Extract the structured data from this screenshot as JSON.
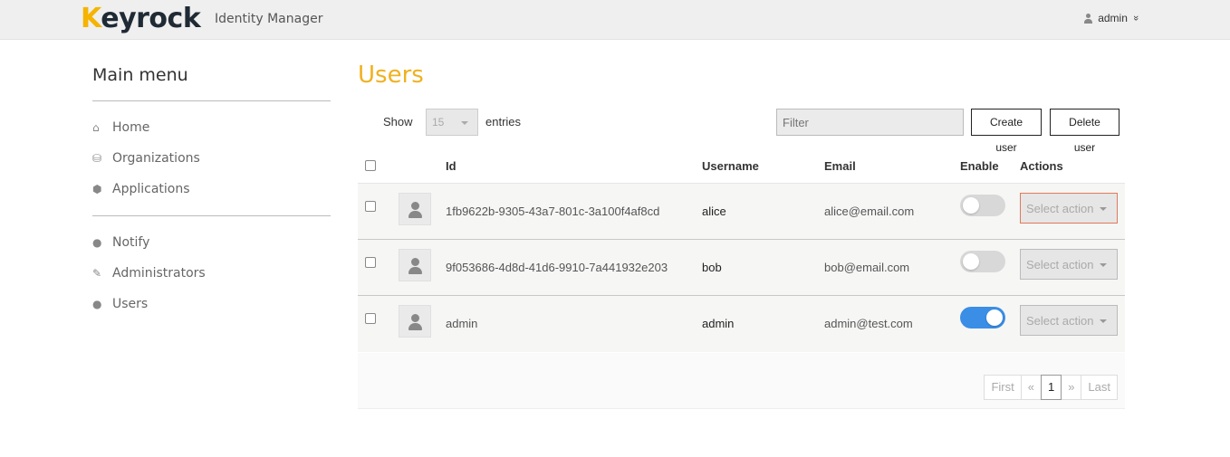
{
  "header": {
    "logo_k": "K",
    "logo_rest": "eyrock",
    "app_title": "Identity Manager",
    "user_label": "admin",
    "user_caret": "»"
  },
  "sidebar": {
    "title": "Main menu",
    "items": [
      {
        "label": "Home",
        "icon": "⌂"
      },
      {
        "label": "Organizations",
        "icon": "⛁"
      },
      {
        "label": "Applications",
        "icon": "⬢"
      },
      {
        "label": "Notify",
        "icon": "●"
      },
      {
        "label": "Administrators",
        "icon": "✎"
      },
      {
        "label": "Users",
        "icon": "●"
      }
    ]
  },
  "main": {
    "title": "Users",
    "show_label": "Show",
    "entries_value": "15",
    "entries_label": "entries",
    "filter_placeholder": "Filter",
    "create_label": "Create user",
    "delete_label": "Delete user"
  },
  "table": {
    "columns": [
      "Id",
      "Username",
      "Email",
      "Enable",
      "Actions"
    ],
    "rows": [
      {
        "id": "1fb9622b-9305-43a7-801c-3a100f4af8cd",
        "username": "alice",
        "email": "alice@email.com",
        "enabled": false,
        "action": "Select action"
      },
      {
        "id": "9f053686-4d8d-41d6-9910-7a441932e203",
        "username": "bob",
        "email": "bob@email.com",
        "enabled": false,
        "action": "Select action"
      },
      {
        "id": "admin",
        "username": "admin",
        "email": "admin@test.com",
        "enabled": true,
        "action": "Select action"
      }
    ]
  },
  "pager": {
    "first": "First",
    "prev": "«",
    "current": "1",
    "next": "»",
    "last": "Last"
  },
  "colors": {
    "accent": "#f0b120",
    "toggle_on": "#3a8ee6"
  }
}
